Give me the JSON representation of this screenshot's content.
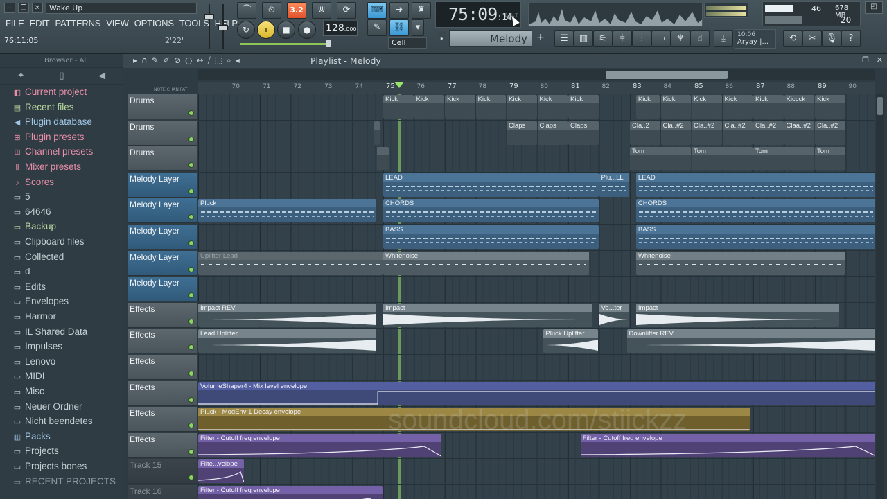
{
  "window": {
    "song_title": "Wake Up",
    "minimize": "–",
    "restore": "❐",
    "close": "✕"
  },
  "menu": [
    "FILE",
    "EDIT",
    "PATTERNS",
    "VIEW",
    "OPTIONS",
    "TOOLS",
    "HELP"
  ],
  "hint": {
    "time": "76:11:05",
    "length": "2'22\""
  },
  "transport": {
    "tempo": "128",
    "tempo_decimals": ".000",
    "clock_main": "75:09",
    "clock_sub": ":14",
    "clock_tiny": "B:S:T",
    "snap": "Cell",
    "pattern": "Melody",
    "pattern_add": "+",
    "play_icon": "▶",
    "pause_icon": "⏸",
    "stop_icon": "■",
    "record_icon": "●",
    "mode_badge": "3.2"
  },
  "monitor": {
    "cpu": "46",
    "ram": "678 MB",
    "poly": "20"
  },
  "news": {
    "time": "10:06",
    "name": "Aryay |..."
  },
  "browser": {
    "header": "Browser - All",
    "items": [
      {
        "label": "Current project",
        "style": "pink",
        "icon": "◧"
      },
      {
        "label": "Recent files",
        "style": "green",
        "icon": "▤"
      },
      {
        "label": "Plugin database",
        "style": "blue",
        "icon": "◀"
      },
      {
        "label": "Plugin presets",
        "style": "pink",
        "icon": "⊞"
      },
      {
        "label": "Channel presets",
        "style": "pink",
        "icon": "⊞"
      },
      {
        "label": "Mixer presets",
        "style": "pink",
        "icon": "⫼"
      },
      {
        "label": "Scores",
        "style": "pink",
        "icon": "♪"
      },
      {
        "label": "5",
        "style": "folder",
        "icon": "▭"
      },
      {
        "label": "64646",
        "style": "folder",
        "icon": "▭"
      },
      {
        "label": "Backup",
        "style": "green",
        "icon": "▭"
      },
      {
        "label": "Clipboard files",
        "style": "folder",
        "icon": "▭"
      },
      {
        "label": "Collected",
        "style": "folder",
        "icon": "▭"
      },
      {
        "label": "d",
        "style": "folder",
        "icon": "▭"
      },
      {
        "label": "Edits",
        "style": "folder",
        "icon": "▭"
      },
      {
        "label": "Envelopes",
        "style": "folder",
        "icon": "▭"
      },
      {
        "label": "Harmor",
        "style": "folder",
        "icon": "▭"
      },
      {
        "label": "IL Shared Data",
        "style": "folder",
        "icon": "▭"
      },
      {
        "label": "Impulses",
        "style": "folder",
        "icon": "▭"
      },
      {
        "label": "Lenovo",
        "style": "folder",
        "icon": "▭"
      },
      {
        "label": "MIDI",
        "style": "folder",
        "icon": "▭"
      },
      {
        "label": "Misc",
        "style": "folder",
        "icon": "▭"
      },
      {
        "label": "Neuer Ordner",
        "style": "folder",
        "icon": "▭"
      },
      {
        "label": "Nicht beendetes",
        "style": "folder",
        "icon": "▭"
      },
      {
        "label": "Packs",
        "style": "blue",
        "icon": "▥"
      },
      {
        "label": "Projects",
        "style": "folder",
        "icon": "▭"
      },
      {
        "label": "Projects bones",
        "style": "folder",
        "icon": "▭"
      },
      {
        "label": "RECENT PROJECTS",
        "style": "faded",
        "icon": "▭"
      }
    ]
  },
  "playlist": {
    "title": "Playlist - Melody",
    "bars": [
      "70",
      "71",
      "72",
      "73",
      "74",
      "75",
      "76",
      "77",
      "78",
      "79",
      "80",
      "81",
      "82",
      "83",
      "84",
      "85",
      "86",
      "87",
      "88",
      "89",
      "90"
    ],
    "header_tabs": "NOTE  CHAN  PAT",
    "tracks": [
      {
        "name": "Drums",
        "style": "drum"
      },
      {
        "name": "Drums",
        "style": "drum"
      },
      {
        "name": "Drums",
        "style": "drum"
      },
      {
        "name": "Melody Layer",
        "style": "melody"
      },
      {
        "name": "Melody Layer",
        "style": "melody"
      },
      {
        "name": "Melody Layer",
        "style": "melody"
      },
      {
        "name": "Melody Layer",
        "style": "melody"
      },
      {
        "name": "Melody Layer",
        "style": "melody"
      },
      {
        "name": "Effects",
        "style": "drum"
      },
      {
        "name": "Effects",
        "style": "drum"
      },
      {
        "name": "Effects",
        "style": "drum"
      },
      {
        "name": "Effects",
        "style": "drum"
      },
      {
        "name": "Effects",
        "style": "drum"
      },
      {
        "name": "Effects",
        "style": "drum"
      },
      {
        "name": "Track 15",
        "style": "empty"
      },
      {
        "name": "Track 16",
        "style": "empty"
      }
    ],
    "clips": [
      {
        "track": 0,
        "start": 75.0,
        "end": 76.0,
        "label": "Kick",
        "kind": "drum"
      },
      {
        "track": 0,
        "start": 76.0,
        "end": 77.0,
        "label": "Kick",
        "kind": "drum"
      },
      {
        "track": 0,
        "start": 77.0,
        "end": 78.0,
        "label": "Kick",
        "kind": "drum"
      },
      {
        "track": 0,
        "start": 78.0,
        "end": 79.0,
        "label": "Kick",
        "kind": "drum"
      },
      {
        "track": 0,
        "start": 79.0,
        "end": 80.0,
        "label": "Kick",
        "kind": "drum"
      },
      {
        "track": 0,
        "start": 80.0,
        "end": 81.0,
        "label": "Kick",
        "kind": "drum"
      },
      {
        "track": 0,
        "start": 81.0,
        "end": 82.0,
        "label": "Kick",
        "kind": "drum"
      },
      {
        "track": 0,
        "start": 83.2,
        "end": 84.0,
        "label": "Kick",
        "kind": "drum"
      },
      {
        "track": 0,
        "start": 84.0,
        "end": 85.0,
        "label": "Kick",
        "kind": "drum"
      },
      {
        "track": 0,
        "start": 85.0,
        "end": 86.0,
        "label": "Kick",
        "kind": "drum"
      },
      {
        "track": 0,
        "start": 86.0,
        "end": 87.0,
        "label": "Kick",
        "kind": "drum"
      },
      {
        "track": 0,
        "start": 87.0,
        "end": 88.0,
        "label": "Kick",
        "kind": "drum"
      },
      {
        "track": 0,
        "start": 88.0,
        "end": 89.0,
        "label": "Kiccck",
        "kind": "drum"
      },
      {
        "track": 0,
        "start": 89.0,
        "end": 90.0,
        "label": "Kick",
        "kind": "drum"
      },
      {
        "track": 1,
        "start": 74.7,
        "end": 74.9,
        "label": "",
        "kind": "drum"
      },
      {
        "track": 1,
        "start": 79.0,
        "end": 80.0,
        "label": "Claps",
        "kind": "drum"
      },
      {
        "track": 1,
        "start": 80.0,
        "end": 81.0,
        "label": "Claps",
        "kind": "drum"
      },
      {
        "track": 1,
        "start": 81.0,
        "end": 82.0,
        "label": "Claps",
        "kind": "drum"
      },
      {
        "track": 1,
        "start": 83.0,
        "end": 84.0,
        "label": "Cla..2",
        "kind": "drum"
      },
      {
        "track": 1,
        "start": 84.0,
        "end": 85.0,
        "label": "Cla..#2",
        "kind": "drum"
      },
      {
        "track": 1,
        "start": 85.0,
        "end": 86.0,
        "label": "Cla..#2",
        "kind": "drum"
      },
      {
        "track": 1,
        "start": 86.0,
        "end": 87.0,
        "label": "Cla..#2",
        "kind": "drum"
      },
      {
        "track": 1,
        "start": 87.0,
        "end": 88.0,
        "label": "Cla..#2",
        "kind": "drum"
      },
      {
        "track": 1,
        "start": 88.0,
        "end": 89.0,
        "label": "Claa..#2",
        "kind": "drum"
      },
      {
        "track": 1,
        "start": 89.0,
        "end": 90.0,
        "label": "Cla..#2",
        "kind": "drum"
      },
      {
        "track": 2,
        "start": 74.8,
        "end": 75.2,
        "label": "",
        "kind": "drum"
      },
      {
        "track": 2,
        "start": 83.0,
        "end": 85.0,
        "label": "Tom",
        "kind": "drum"
      },
      {
        "track": 2,
        "start": 85.0,
        "end": 87.0,
        "label": "Tom",
        "kind": "drum"
      },
      {
        "track": 2,
        "start": 87.0,
        "end": 89.0,
        "label": "Tom",
        "kind": "drum"
      },
      {
        "track": 2,
        "start": 89.0,
        "end": 90.0,
        "label": "Tom",
        "kind": "drum"
      },
      {
        "track": 3,
        "start": 75.0,
        "end": 82.0,
        "label": "LEAD",
        "kind": "mel"
      },
      {
        "track": 3,
        "start": 82.0,
        "end": 83.0,
        "label": "Plu...LL",
        "kind": "mel"
      },
      {
        "track": 3,
        "start": 83.2,
        "end": 91.0,
        "label": "LEAD",
        "kind": "mel"
      },
      {
        "track": 4,
        "start": 69.0,
        "end": 74.8,
        "label": "Pluck",
        "kind": "mel"
      },
      {
        "track": 4,
        "start": 75.0,
        "end": 82.0,
        "label": "CHORDS",
        "kind": "mel"
      },
      {
        "track": 4,
        "start": 83.2,
        "end": 91.0,
        "label": "CHORDS",
        "kind": "mel"
      },
      {
        "track": 5,
        "start": 75.0,
        "end": 82.0,
        "label": "BASS",
        "kind": "mel"
      },
      {
        "track": 5,
        "start": 83.2,
        "end": 91.0,
        "label": "BASS",
        "kind": "mel"
      },
      {
        "track": 6,
        "start": 69.0,
        "end": 75.0,
        "label": "Uplifter Lead",
        "kind": "noise-dim"
      },
      {
        "track": 6,
        "start": 75.0,
        "end": 81.7,
        "label": "Whitenoise",
        "kind": "noise"
      },
      {
        "track": 6,
        "start": 83.2,
        "end": 90.0,
        "label": "Whitenoise",
        "kind": "noise"
      },
      {
        "track": 8,
        "start": 69.0,
        "end": 74.8,
        "label": "Impact REV",
        "kind": "audio"
      },
      {
        "track": 8,
        "start": 75.0,
        "end": 81.8,
        "label": "Impact",
        "kind": "audio"
      },
      {
        "track": 8,
        "start": 82.0,
        "end": 83.0,
        "label": "Vo...ter",
        "kind": "audio"
      },
      {
        "track": 8,
        "start": 83.2,
        "end": 89.8,
        "label": "Impact",
        "kind": "audio"
      },
      {
        "track": 9,
        "start": 69.0,
        "end": 74.8,
        "label": "Lead Uplifter",
        "kind": "audio"
      },
      {
        "track": 9,
        "start": 80.2,
        "end": 82.0,
        "label": "Pluck Uplifter",
        "kind": "audio"
      },
      {
        "track": 9,
        "start": 82.9,
        "end": 91.0,
        "label": "Downlifter REV",
        "kind": "audio"
      },
      {
        "track": 11,
        "start": 69.0,
        "end": 91.0,
        "label": "VolumeShaper4 - Mix level envelope",
        "kind": "auto-blue"
      },
      {
        "track": 12,
        "start": 69.0,
        "end": 86.9,
        "label": "Pluck - ModEnv 1 Decay envelope",
        "kind": "auto-gold"
      },
      {
        "track": 13,
        "start": 69.0,
        "end": 76.9,
        "label": "Filter - Cutoff freq envelope",
        "kind": "auto-purple"
      },
      {
        "track": 13,
        "start": 81.4,
        "end": 91.0,
        "label": "Filter - Cutoff freq envelope",
        "kind": "auto-purple"
      },
      {
        "track": 14,
        "start": 69.0,
        "end": 70.5,
        "label": "Filte...velope",
        "kind": "auto-purple"
      },
      {
        "track": 15,
        "start": 69.0,
        "end": 75.0,
        "label": "Filter - Cutoff freq envelope",
        "kind": "auto-purple"
      }
    ],
    "playhead_bar": 75.5
  },
  "watermark": "soundcloud.com/stiickzz",
  "colors": {
    "accent_green": "#9be36a",
    "accent_orange": "#e0522c",
    "accent_blue": "#3a96d2"
  }
}
